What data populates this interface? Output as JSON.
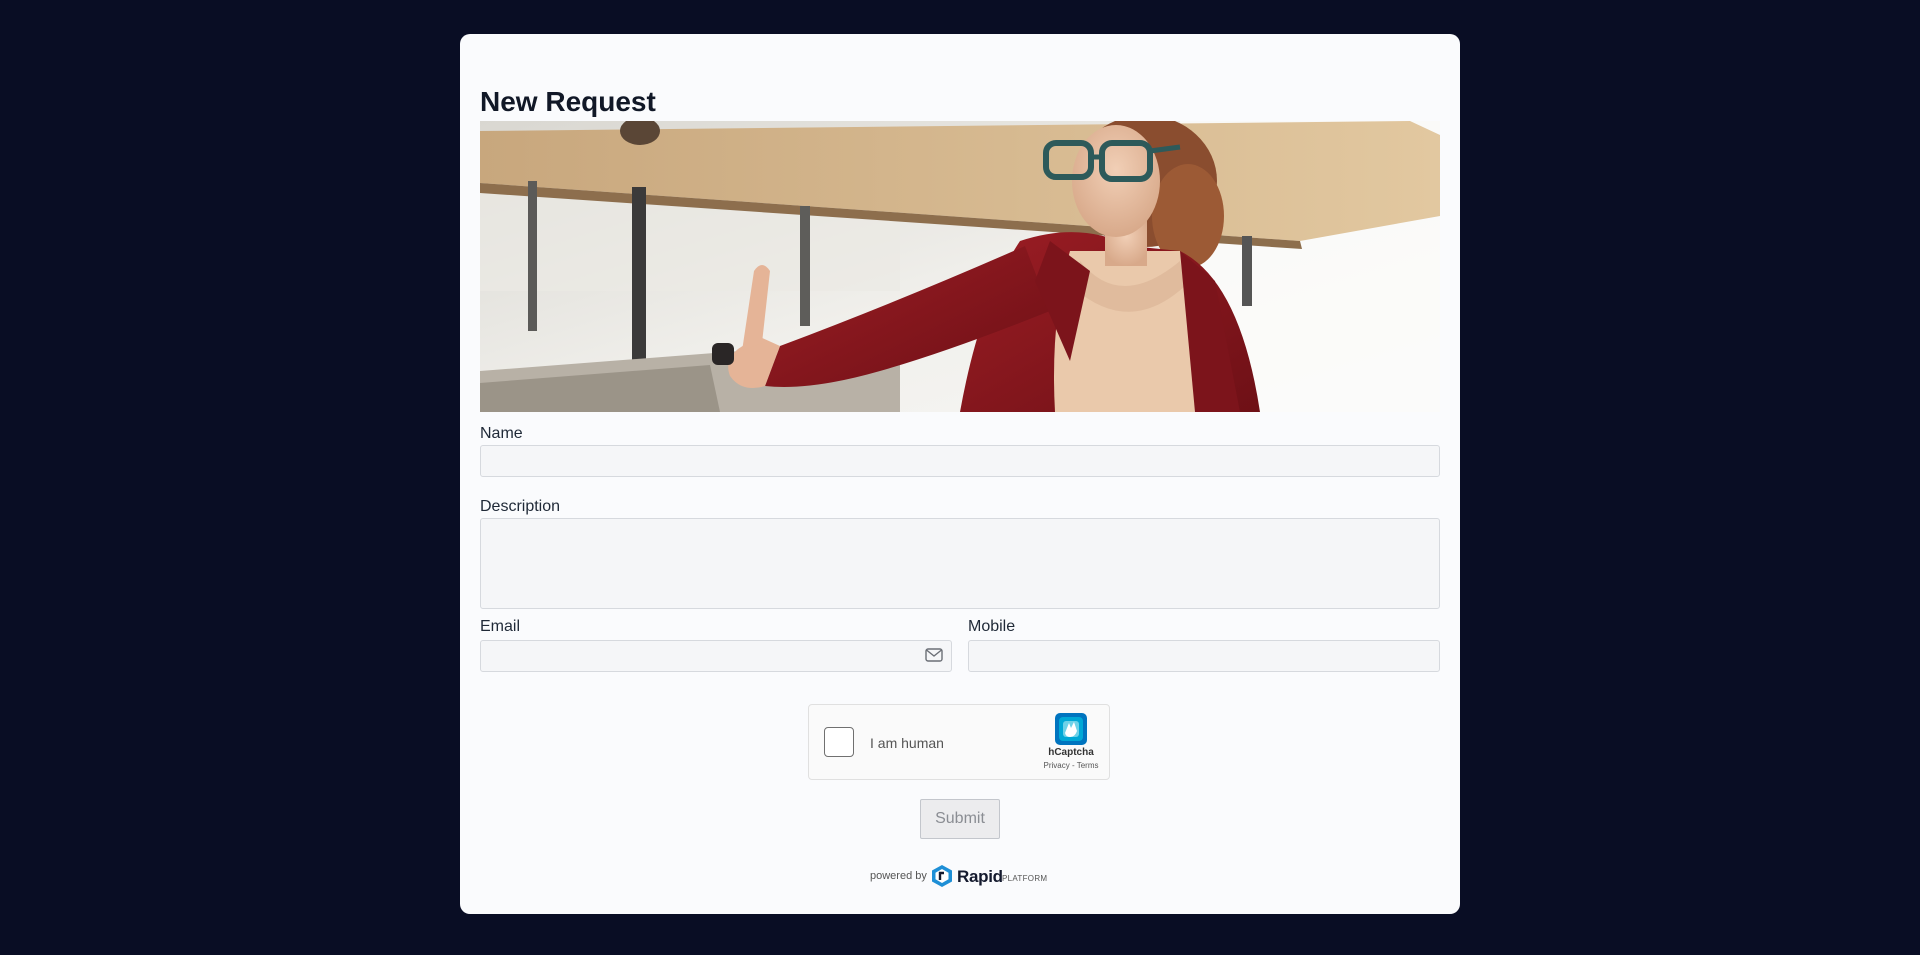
{
  "form": {
    "title": "New Request",
    "banner_alt": "",
    "fields": {
      "name": {
        "label": "Name",
        "value": ""
      },
      "description": {
        "label": "Description",
        "value": ""
      },
      "email": {
        "label": "Email",
        "value": ""
      },
      "mobile": {
        "label": "Mobile",
        "value": ""
      }
    },
    "captcha": {
      "label": "I am human",
      "brand": "hCaptcha",
      "links": "Privacy - Terms"
    },
    "submit_label": "Submit"
  },
  "footer": {
    "powered_by": "powered by",
    "brand": "Rapid",
    "brand_suffix": "PLATFORM"
  },
  "colors": {
    "page_background": "#090d24",
    "card_background": "#fafbfd",
    "brand_accent": "#1e8fd6"
  }
}
